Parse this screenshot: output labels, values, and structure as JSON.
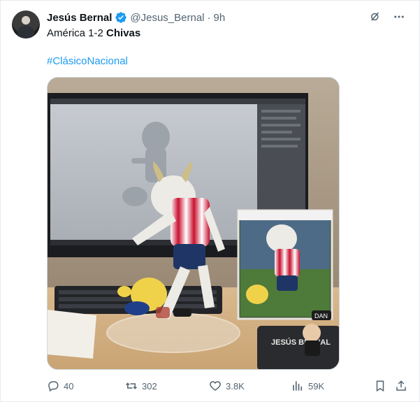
{
  "author": {
    "name": "Jesús Bernal",
    "handle": "@Jesus_Bernal",
    "separator": "·",
    "time": "9h",
    "avatar_icon": "person-avatar-icon",
    "verified_icon": "verified-badge-icon"
  },
  "tweet": {
    "text_prefix": "América 1-2 ",
    "text_bold": "Chivas",
    "hashtag": "#ClásicoNacional"
  },
  "media": {
    "image_icon": "photo-image-icon",
    "watermark": "JESÚS BERNAL",
    "box_badge": "DAN"
  },
  "header_icons": [
    "grok-icon",
    "more-icon"
  ],
  "actions": {
    "reply_count": "40",
    "retweet_count": "302",
    "like_count": "3.8K",
    "view_count": "59K"
  },
  "colors": {
    "accent": "#1d9bf0",
    "text": "#0f1419",
    "muted": "#536471",
    "border": "#e6ecf0"
  }
}
